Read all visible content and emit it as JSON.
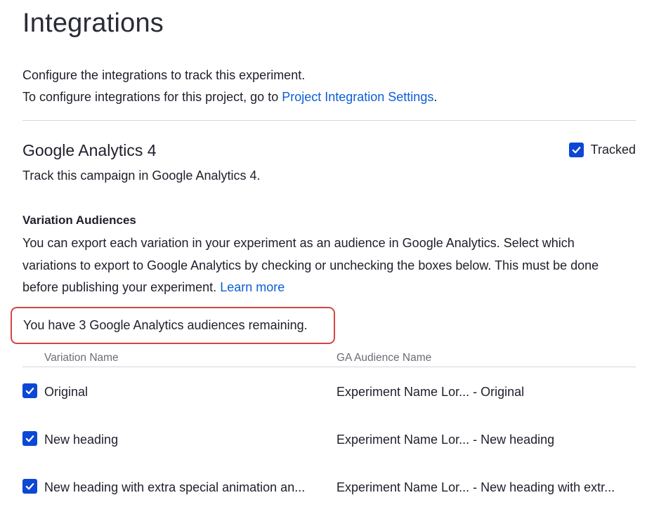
{
  "page": {
    "title": "Integrations",
    "intro_line1": "Configure the integrations to track this experiment.",
    "intro_line2_prefix": "To configure integrations for this project, go to ",
    "intro_link": "Project Integration Settings",
    "intro_line2_suffix": "."
  },
  "integration": {
    "title": "Google Analytics 4",
    "tracked_label": "Tracked",
    "tracked_checked": true,
    "description": "Track this campaign in Google Analytics 4."
  },
  "audiences": {
    "title": "Variation Audiences",
    "description": "You can export each variation in your experiment as an audience in Google Analytics. Select which variations to export to Google Analytics by checking or unchecking the boxes below. This must be done before publishing your experiment.",
    "learn_more": "Learn more",
    "remaining": "You have 3 Google Analytics audiences remaining."
  },
  "table": {
    "headers": {
      "variation": "Variation Name",
      "ga": "GA Audience Name"
    },
    "rows": [
      {
        "checked": true,
        "name": "Original",
        "ga_name": "Experiment Name Lor... - Original"
      },
      {
        "checked": true,
        "name": "New heading",
        "ga_name": "Experiment Name Lor... - New heading"
      },
      {
        "checked": true,
        "name": "New heading with extra special animation an...",
        "ga_name": "Experiment Name Lor... - New heading with extr..."
      }
    ]
  },
  "colors": {
    "accent": "#0c47d6",
    "link": "#0b5ed7",
    "highlight_border": "#d64545"
  }
}
